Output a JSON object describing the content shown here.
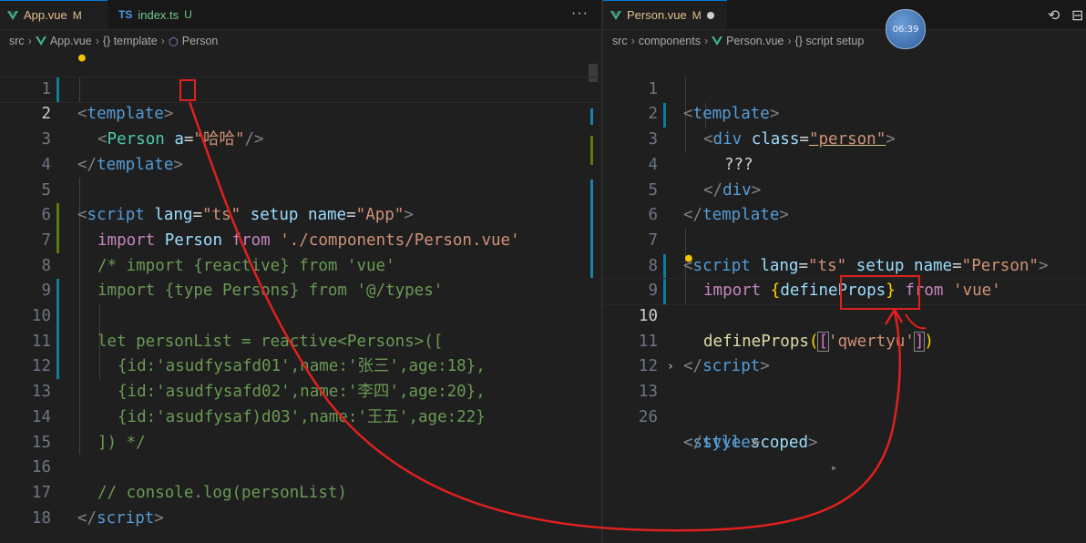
{
  "left": {
    "tabs": [
      {
        "label": "App.vue",
        "badge": "M",
        "icon": "vue-icon"
      },
      {
        "label": "index.ts",
        "badge": "U",
        "icon": "ts-icon",
        "icon_text": "TS"
      }
    ],
    "more": "···",
    "breadcrumb": [
      "src",
      "App.vue",
      "{} template",
      "Person"
    ],
    "line_numbers": [
      "1",
      "2",
      "3",
      "4",
      "5",
      "6",
      "7",
      "8",
      "9",
      "10",
      "11",
      "12",
      "13",
      "14",
      "15",
      "16",
      "17",
      "18"
    ]
  },
  "right": {
    "tabs": [
      {
        "label": "Person.vue",
        "badge": "M",
        "icon": "vue-icon"
      }
    ],
    "breadcrumb": [
      "src",
      "components",
      "Person.vue",
      "{} script setup"
    ],
    "line_numbers": [
      "1",
      "2",
      "3",
      "4",
      "5",
      "6",
      "7",
      "8",
      "9",
      "10",
      "11",
      "12",
      "13",
      "26"
    ]
  },
  "overlay": {
    "clock_text": "06:39"
  },
  "code_left": {
    "l1": [
      "<",
      "template",
      ">"
    ],
    "l2": [
      "<",
      "Person",
      "a",
      "=",
      "\"哈哈\"",
      "/>"
    ],
    "l3": [
      "</",
      "template",
      ">"
    ],
    "l5": [
      "<",
      "script",
      "lang",
      "=",
      "\"ts\"",
      "setup",
      "name",
      "=",
      "\"App\"",
      ">"
    ],
    "l6": [
      "import",
      "Person",
      "from",
      "'./components/Person.vue'"
    ],
    "l7": "/* import {reactive} from 'vue'",
    "l8": "import {type Persons} from '@/types'",
    "l10": "let personList = reactive<Persons>([",
    "l11": "{id:'asudfysafd01',name:'张三',age:18},",
    "l12": "{id:'asudfysafd02',name:'李四',age:20},",
    "l13": "{id:'asudfysaf)d03',name:'王五',age:22}",
    "l14": "]) */",
    "l16": "// console.log(personList)",
    "l17": [
      "</",
      "script",
      ">"
    ]
  },
  "code_right": {
    "l1": [
      "<",
      "template",
      ">"
    ],
    "l2": [
      "<",
      "div",
      "class",
      "=",
      "\"person\"",
      ">"
    ],
    "l3": "???",
    "l4": [
      "</",
      "div",
      ">"
    ],
    "l5": [
      "</",
      "template",
      ">"
    ],
    "l7": [
      "<",
      "script",
      "lang",
      "=",
      "\"ts\"",
      "setup",
      "name",
      "=",
      "\"Person\"",
      ">"
    ],
    "l8": [
      "import",
      "{",
      "defineProps",
      "}",
      "from",
      "'vue'"
    ],
    "l10": [
      "defineProps",
      "(",
      "[",
      "'qwertyu'",
      "]",
      ")"
    ],
    "l11": [
      "</",
      "script",
      ">"
    ],
    "l13": [
      "<",
      "style",
      "scoped",
      ">"
    ],
    "l26": [
      "</",
      "style",
      ">"
    ]
  }
}
